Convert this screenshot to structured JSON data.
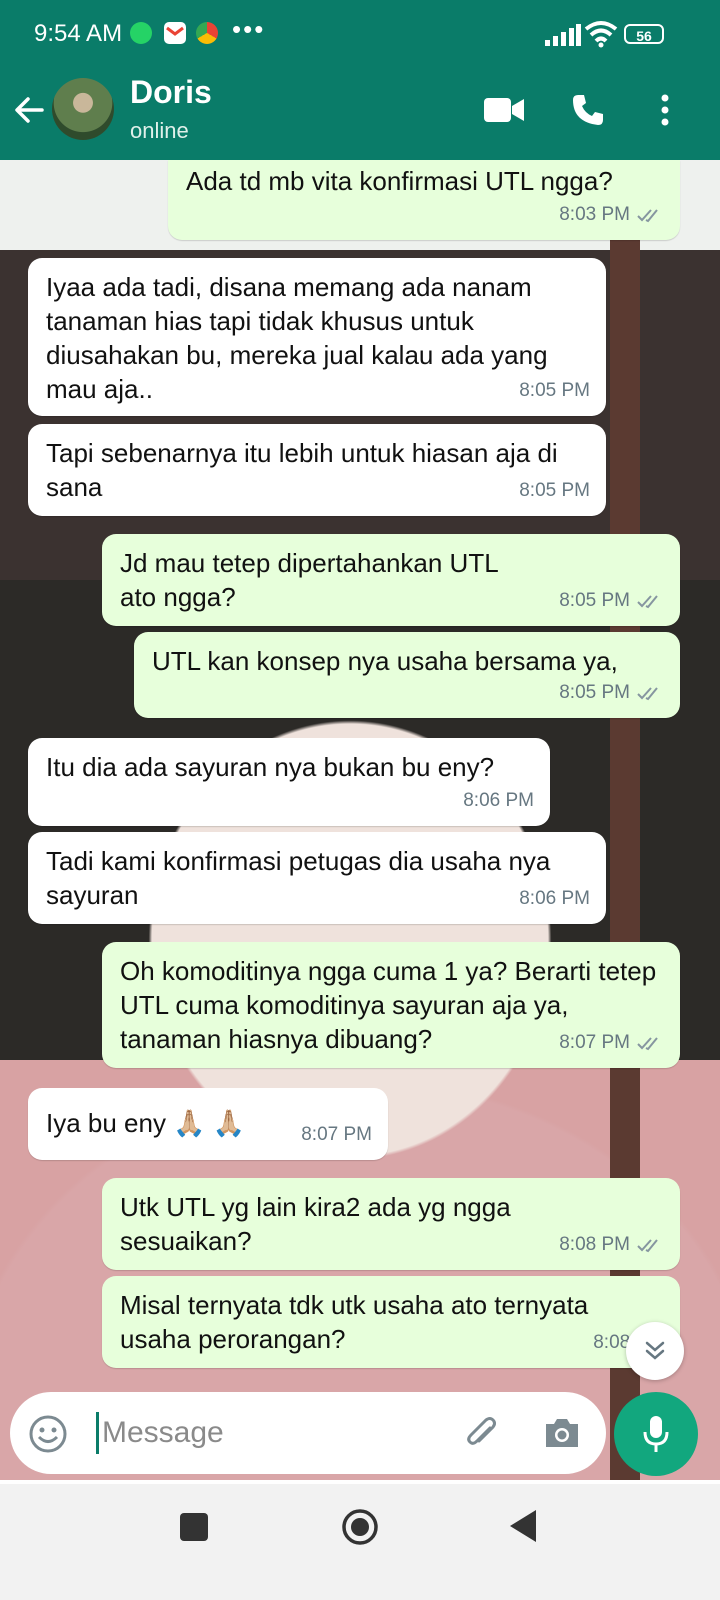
{
  "status_bar": {
    "time": "9:54 AM",
    "more": "•••",
    "battery": "56"
  },
  "header": {
    "name": "Doris",
    "status": "online"
  },
  "messages": [
    {
      "dir": "out",
      "text": "Ada td mb vita konfirmasi UTL ngga?",
      "time": "8:03 PM"
    },
    {
      "dir": "in",
      "text": "Iyaa ada tadi, disana memang ada nanam tanaman hias tapi tidak khusus untuk diusahakan bu, mereka jual kalau ada yang mau aja..",
      "time": "8:05 PM"
    },
    {
      "dir": "in",
      "text": "Tapi sebenarnya itu lebih untuk hiasan aja di sana",
      "time": "8:05 PM"
    },
    {
      "dir": "out",
      "text": "Jd mau tetep dipertahankan UTL ato ngga?",
      "time": "8:05 PM"
    },
    {
      "dir": "out",
      "text": "UTL kan konsep nya usaha bersama ya,",
      "time": "8:05 PM"
    },
    {
      "dir": "in",
      "text": "Itu dia ada sayuran nya bukan bu eny?",
      "time": "8:06 PM"
    },
    {
      "dir": "in",
      "text": "Tadi kami konfirmasi petugas dia usaha nya sayuran",
      "time": "8:06 PM"
    },
    {
      "dir": "out",
      "text": "Oh komoditinya ngga cuma 1 ya? Berarti tetep UTL cuma komoditinya sayuran aja ya, tanaman hiasnya dibuang?",
      "time": "8:07 PM"
    },
    {
      "dir": "in",
      "text": "Iya bu eny 🙏🏼 🙏🏼",
      "time": "8:07 PM"
    },
    {
      "dir": "out",
      "text": "Utk UTL yg lain kira2 ada yg ngga sesuaikan?",
      "time": "8:08 PM"
    },
    {
      "dir": "out",
      "text": "Misal ternyata tdk utk usaha ato ternyata usaha perorangan?",
      "time": "8:08 PM"
    }
  ],
  "input": {
    "placeholder": "Message"
  },
  "colors": {
    "header": "#0a7c69",
    "outgoing_bubble": "#e7ffdb",
    "incoming_bubble": "#ffffff",
    "mic_button": "#12a77e",
    "read_ticks": "#8696a0"
  }
}
